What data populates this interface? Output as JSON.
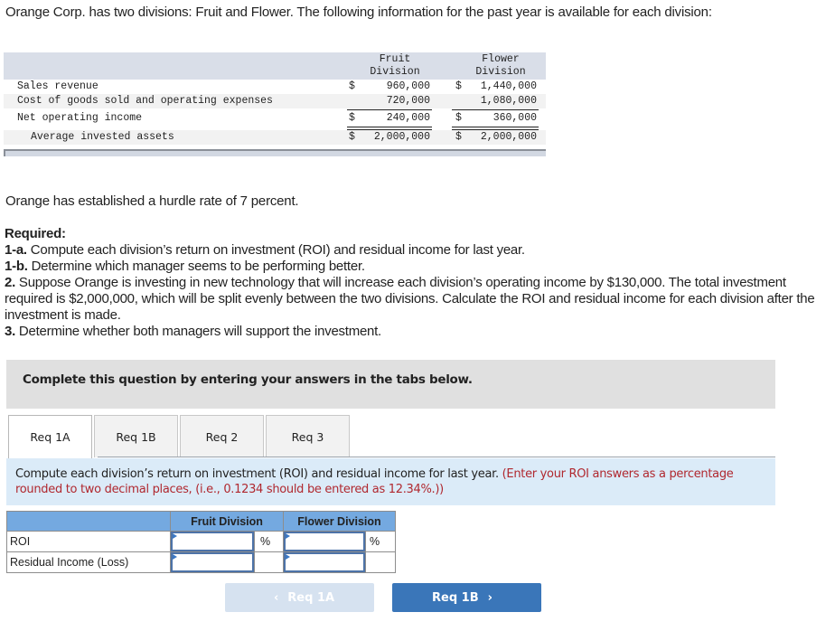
{
  "intro": "Orange Corp. has two divisions: Fruit and Flower. The following information for the past year is available for each division:",
  "data_table": {
    "col_headers": [
      {
        "line1": "Fruit",
        "line2": "Division"
      },
      {
        "line1": "Flower",
        "line2": "Division"
      }
    ],
    "rows": [
      {
        "label": "Sales revenue",
        "fruit_cur": "$",
        "fruit": "960,000",
        "flower_cur": "$",
        "flower": "1,440,000"
      },
      {
        "label": "Cost of goods sold and operating expenses",
        "fruit_cur": "",
        "fruit": "720,000",
        "flower_cur": "",
        "flower": "1,080,000"
      },
      {
        "label": "Net operating income",
        "fruit_cur": "$",
        "fruit": "240,000",
        "flower_cur": "$",
        "flower": "360,000"
      },
      {
        "label": "Average invested assets",
        "fruit_cur": "$",
        "fruit": "2,000,000",
        "flower_cur": "$",
        "flower": "2,000,000"
      }
    ]
  },
  "hurdle": "Orange has established a hurdle rate of 7 percent.",
  "required": {
    "heading": "Required:",
    "items": [
      {
        "num": "1-a.",
        "text": " Compute each division’s return on investment (ROI) and residual income for last year."
      },
      {
        "num": "1-b.",
        "text": " Determine which manager seems to be performing better."
      },
      {
        "num": "2.",
        "text": " Suppose Orange is investing in new technology that will increase each division’s operating income by $130,000. The total investment required is $2,000,000, which will be split evenly between the two divisions. Calculate the ROI and residual income for each division after the investment is made."
      },
      {
        "num": "3.",
        "text": " Determine whether both managers will support the investment."
      }
    ]
  },
  "instruction": "Complete this question by entering your answers in the tabs below.",
  "tabs": [
    {
      "label": "Req 1A",
      "active": true
    },
    {
      "label": "Req 1B",
      "active": false
    },
    {
      "label": "Req 2",
      "active": false
    },
    {
      "label": "Req 3",
      "active": false
    }
  ],
  "prompt": {
    "text": "Compute each division’s return on investment (ROI) and residual income for last year. ",
    "note": "(Enter your ROI answers as a percentage rounded to two decimal places, (i.e., 0.1234 should be entered as 12.34%.))"
  },
  "answer_table": {
    "headers": [
      "Fruit Division",
      "Flower Division"
    ],
    "rows": [
      {
        "label": "ROI",
        "fruit_value": "",
        "fruit_suffix": "%",
        "flower_value": "",
        "flower_suffix": "%"
      },
      {
        "label": "Residual Income (Loss)",
        "fruit_value": "",
        "fruit_suffix": "",
        "flower_value": "",
        "flower_suffix": ""
      }
    ]
  },
  "nav": {
    "prev_label": "Req 1A",
    "prev_icon": "chevron-left-icon",
    "next_label": "Req 1B",
    "next_icon": "chevron-right-icon"
  },
  "colors": {
    "answer_header_bg": "#74a9e0",
    "prompt_bg": "#dbebf8",
    "note_red": "#b0282f",
    "next_button": "#3a76b9",
    "prev_button_disabled": "#d6e2f0"
  }
}
